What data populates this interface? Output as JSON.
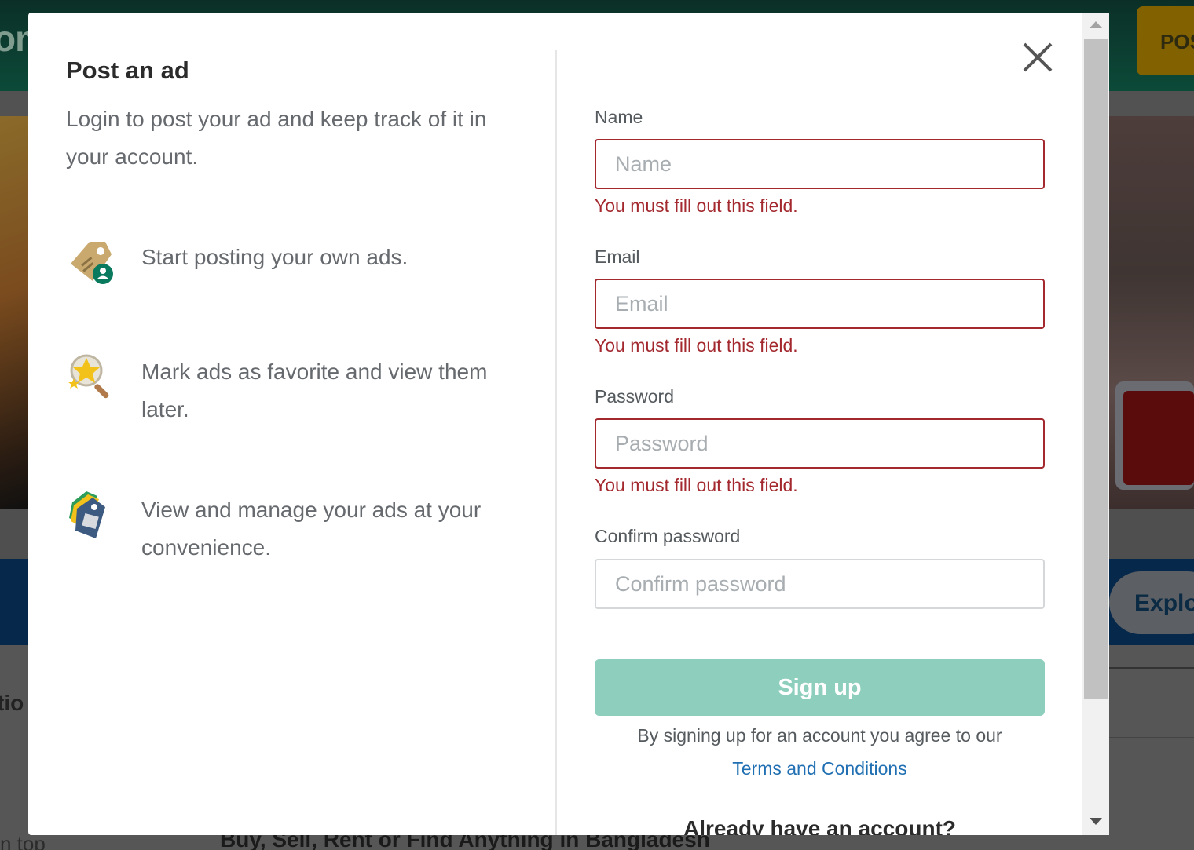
{
  "background": {
    "logo_fragment": "om",
    "post_button": "POS",
    "explore_button": "Explo",
    "section_fragment": "tio",
    "sort_fragment": "n top",
    "tagline": "Buy, Sell, Rent or Find Anything in Bangladesh"
  },
  "modal": {
    "title": "Post an ad",
    "intro": "Login to post your ad and keep track of it in your account.",
    "features": [
      {
        "icon": "ad-tag-user-icon",
        "text": "Start posting your own ads."
      },
      {
        "icon": "favorite-star-search-icon",
        "text": "Mark ads as favorite and view them later."
      },
      {
        "icon": "manage-ads-tags-icon",
        "text": "View and manage your ads at your convenience."
      }
    ],
    "close_icon": "close-icon"
  },
  "form": {
    "name": {
      "label": "Name",
      "placeholder": "Name",
      "value": "",
      "error": "You must fill out this field."
    },
    "email": {
      "label": "Email",
      "placeholder": "Email",
      "value": "",
      "error": "You must fill out this field."
    },
    "password": {
      "label": "Password",
      "placeholder": "Password",
      "value": "",
      "error": "You must fill out this field."
    },
    "confirm_password": {
      "label": "Confirm password",
      "placeholder": "Confirm password",
      "value": ""
    },
    "signup_label": "Sign up",
    "agree_text": "By signing up for an account you agree to our",
    "terms_link": "Terms and Conditions",
    "already_text": "Already have an account?"
  },
  "colors": {
    "error": "#a3292f",
    "signup_button": "#8ecebd",
    "link": "#1f6fb2",
    "header_bg": "#0b2f27"
  }
}
